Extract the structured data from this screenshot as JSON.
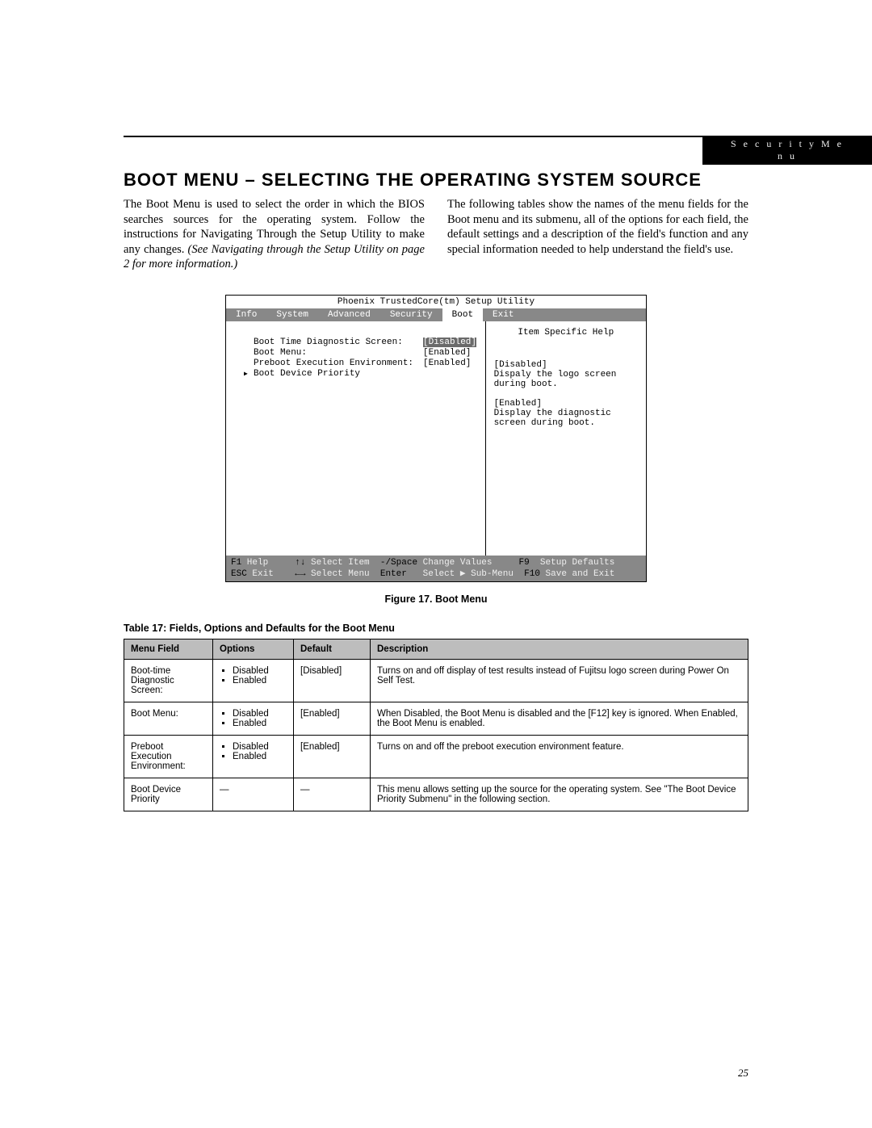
{
  "header": {
    "tag": "S e c u r i t y   M e n u"
  },
  "title": "BOOT MENU – SELECTING THE OPERATING SYSTEM SOURCE",
  "col1": {
    "text_a": "The Boot Menu is used to select the order in which the BIOS searches sources for the operating system. Follow the instructions for Navigating Through the Setup Utility to make any changes. ",
    "text_b": "(See Navigating through the Setup Utility on page 2 for more information.)"
  },
  "col2": {
    "text": "The following tables show the names of the menu fields for the Boot menu and its submenu, all of the options for each field, the default settings and a description of the field's function and any special information needed to help understand the field's use."
  },
  "bios": {
    "title": "Phoenix TrustedCore(tm) Setup Utility",
    "menus": [
      "Info",
      "System",
      "Advanced",
      "Security",
      "Boot",
      "Exit"
    ],
    "active_menu": "Boot",
    "rows": [
      {
        "label": "Boot Time Diagnostic Screen:",
        "value": "[Disabled]",
        "selected": true
      },
      {
        "label": "Boot Menu:",
        "value": "[Enabled]",
        "selected": false
      },
      {
        "label": "Preboot Execution Environment:",
        "value": "[Enabled]",
        "selected": false
      }
    ],
    "submenu": "Boot Device Priority",
    "help_title": "Item Specific Help",
    "help_lines": [
      "[Disabled]",
      "Dispaly the logo screen",
      "during boot.",
      "",
      "[Enabled]",
      "Display the diagnostic",
      "screen during boot."
    ],
    "footer": {
      "r1": {
        "k1": "F1",
        "t1": " Help",
        "k2": "↑↓",
        "t2": " Select Item",
        "k3": "-/Space",
        "t3": " Change Values",
        "k4": "F9",
        "t4": " Setup Defaults"
      },
      "r2": {
        "k1": "ESC",
        "t1": " Exit",
        "k2": "←→",
        "t2": " Select Menu",
        "k3": "Enter",
        "t3": "   Select ▶ Sub-Menu",
        "k4": "F10",
        "t4": " Save and Exit"
      }
    }
  },
  "fig_caption": "Figure 17.  Boot Menu",
  "tbl_caption": "Table 17: Fields, Options and Defaults for the Boot Menu",
  "table": {
    "headers": [
      "Menu Field",
      "Options",
      "Default",
      "Description"
    ],
    "rows": [
      {
        "field": "Boot-time Diagnostic Screen:",
        "options": [
          "Disabled",
          "Enabled"
        ],
        "default": "[Disabled]",
        "desc": "Turns on and off display of test results instead of Fujitsu logo screen during Power On Self Test."
      },
      {
        "field": "Boot Menu:",
        "options": [
          "Disabled",
          "Enabled"
        ],
        "default": "[Enabled]",
        "desc": "When Disabled, the Boot Menu is disabled and the [F12] key is ignored. When Enabled, the Boot Menu is enabled."
      },
      {
        "field": "Preboot Execution Environment:",
        "options": [
          "Disabled",
          "Enabled"
        ],
        "default": "[Enabled]",
        "desc": "Turns on and off the preboot execution environment feature."
      },
      {
        "field": "Boot Device Priority",
        "options": [
          "—"
        ],
        "default": "—",
        "desc": "This menu allows setting up the source for the operating system. See \"The Boot Device Priority Submenu\" in the following section."
      }
    ]
  },
  "page_number": "25"
}
